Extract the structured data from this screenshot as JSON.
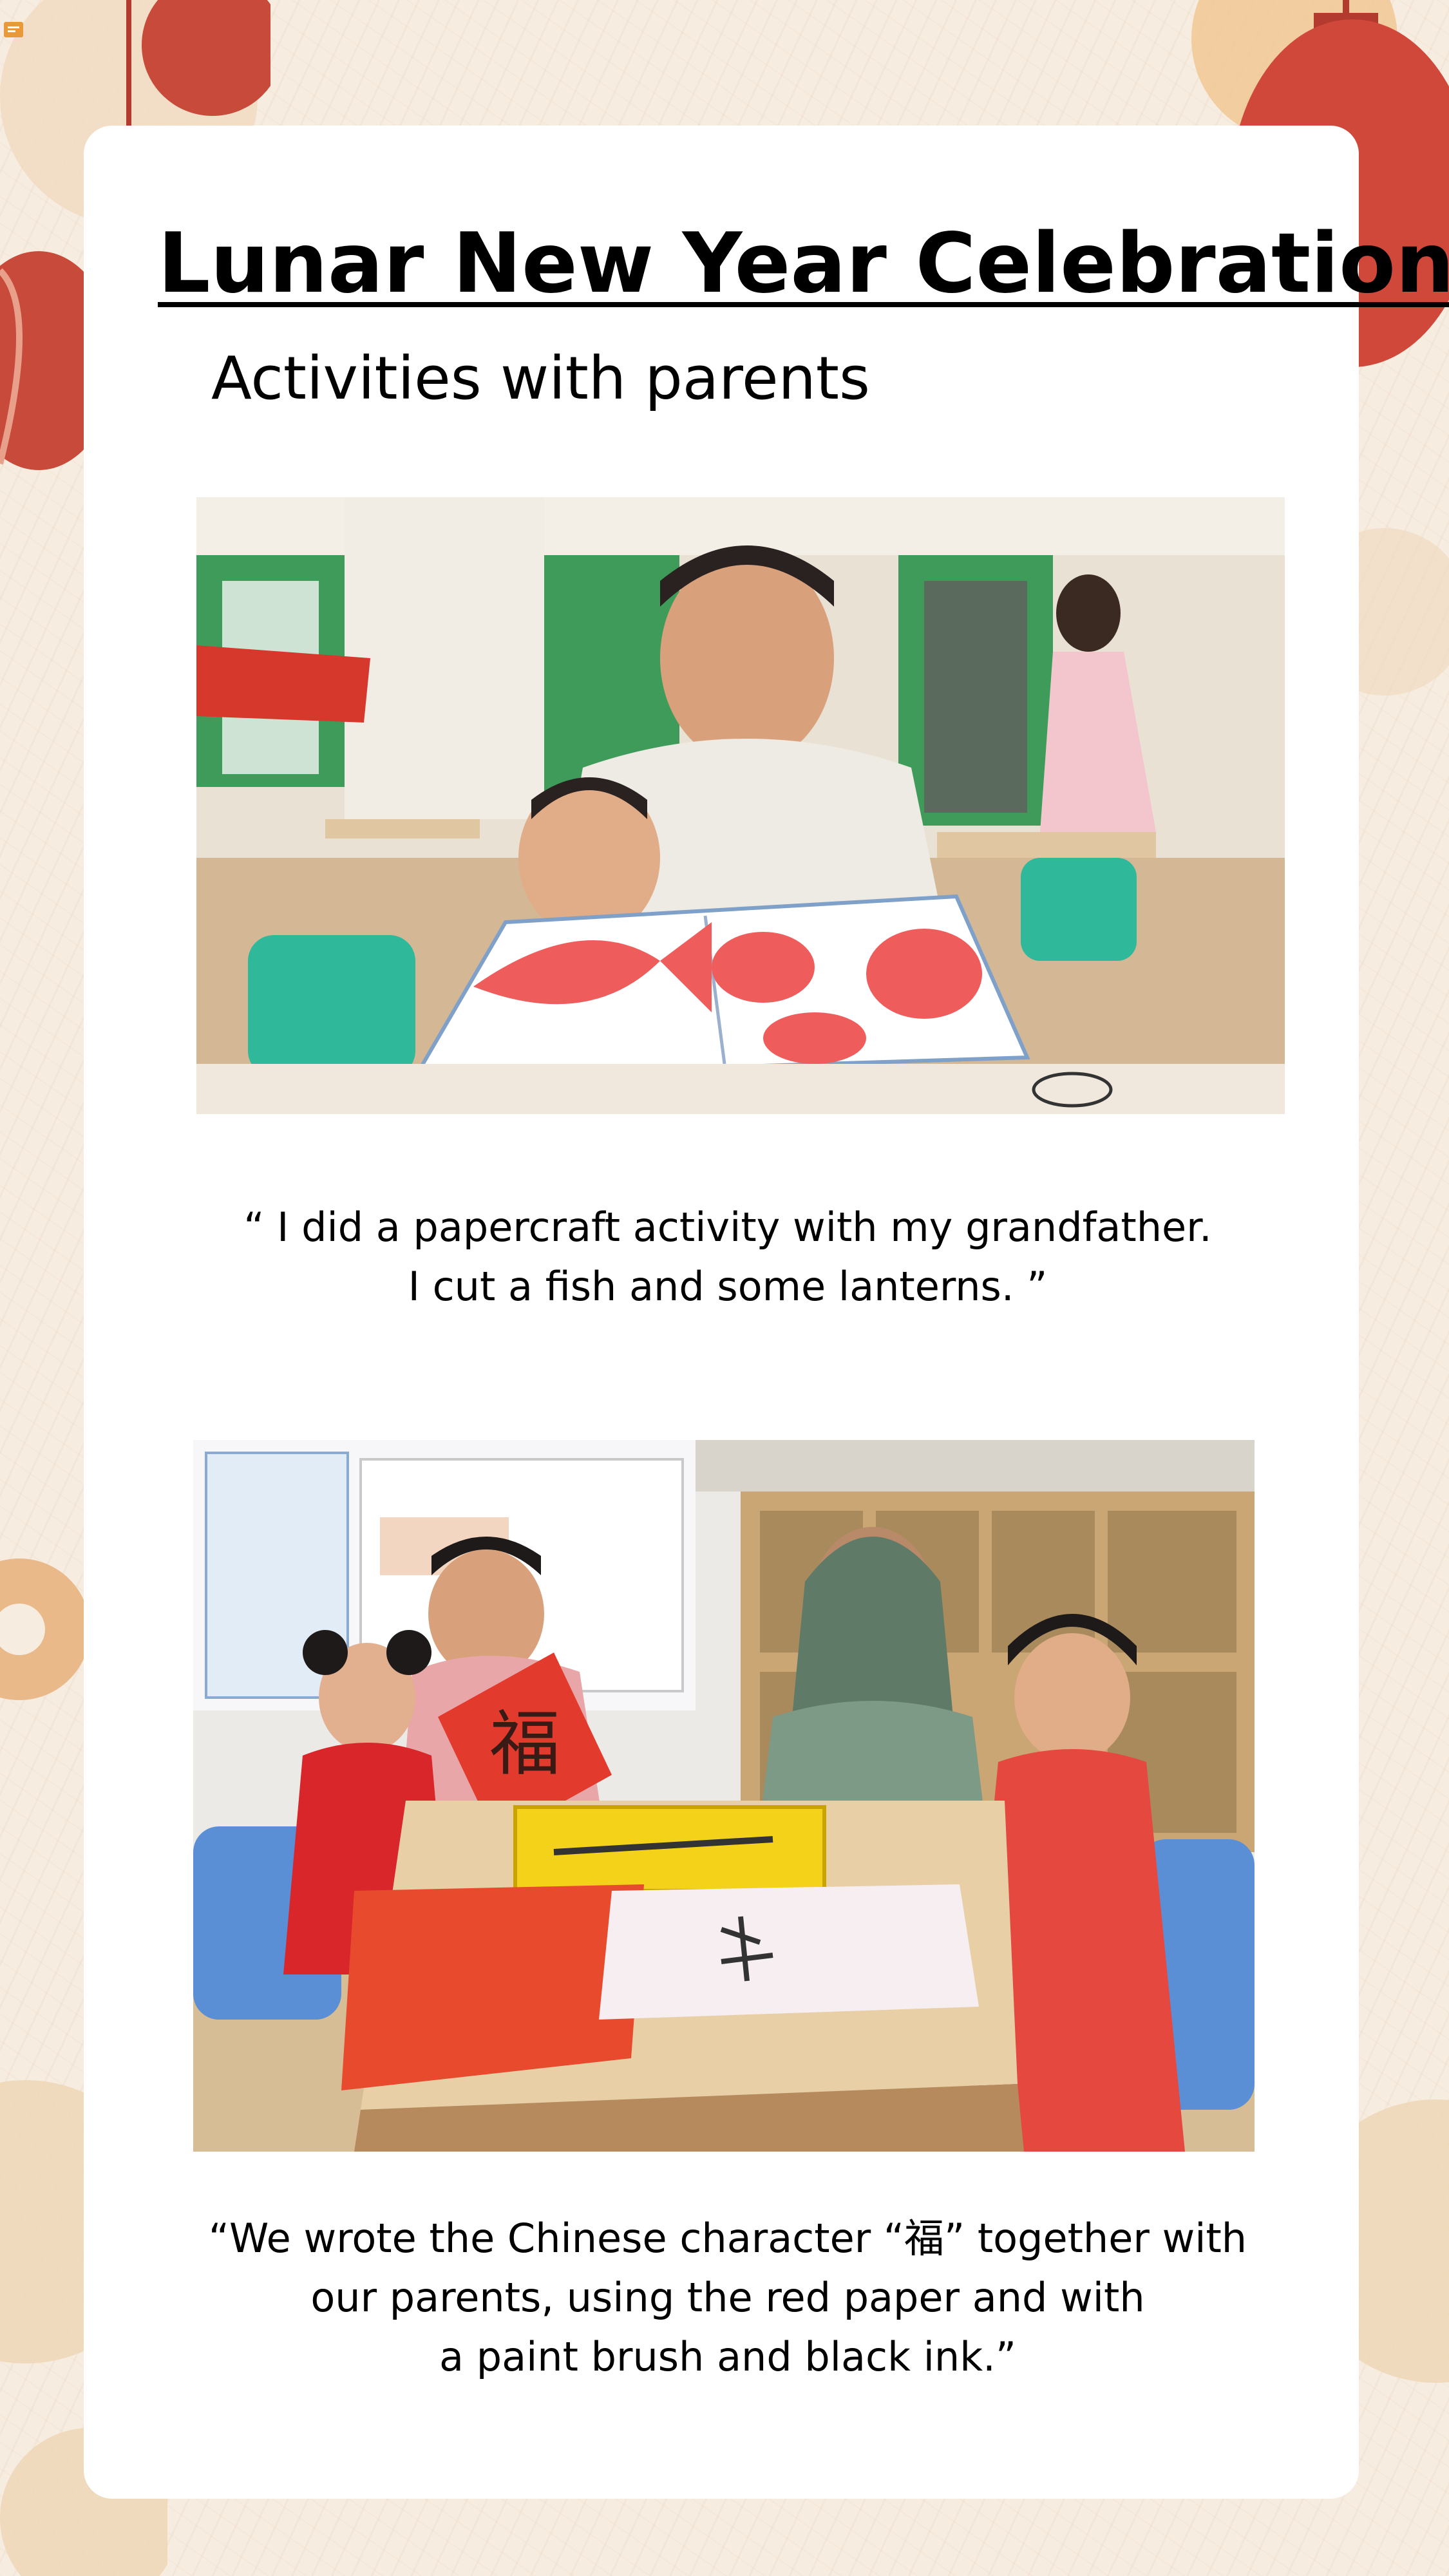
{
  "page": {
    "title": "Lunar New Year Celebrations",
    "subtitle": "Activities with parents"
  },
  "photos": [
    {
      "caption_lines": [
        "“ I did a papercraft activity with my grandfather.",
        "I cut a fish and some lanterns. ”"
      ]
    },
    {
      "banner_character": "福",
      "caption_lines": [
        "“We wrote the Chinese character “福” together with",
        "our parents, using the red paper and with",
        "a paint brush and black ink.”"
      ]
    }
  ],
  "colors": {
    "background": "#f6ece0",
    "card": "#ffffff",
    "lantern": "#c84a3a",
    "blossom": "#e8b07a",
    "paper_red": "#e23b2e",
    "chair_green": "#2fb89a",
    "chair_blue": "#5a8fd6"
  },
  "icons": [
    "lantern-icon",
    "blossom-icon",
    "note-icon"
  ]
}
